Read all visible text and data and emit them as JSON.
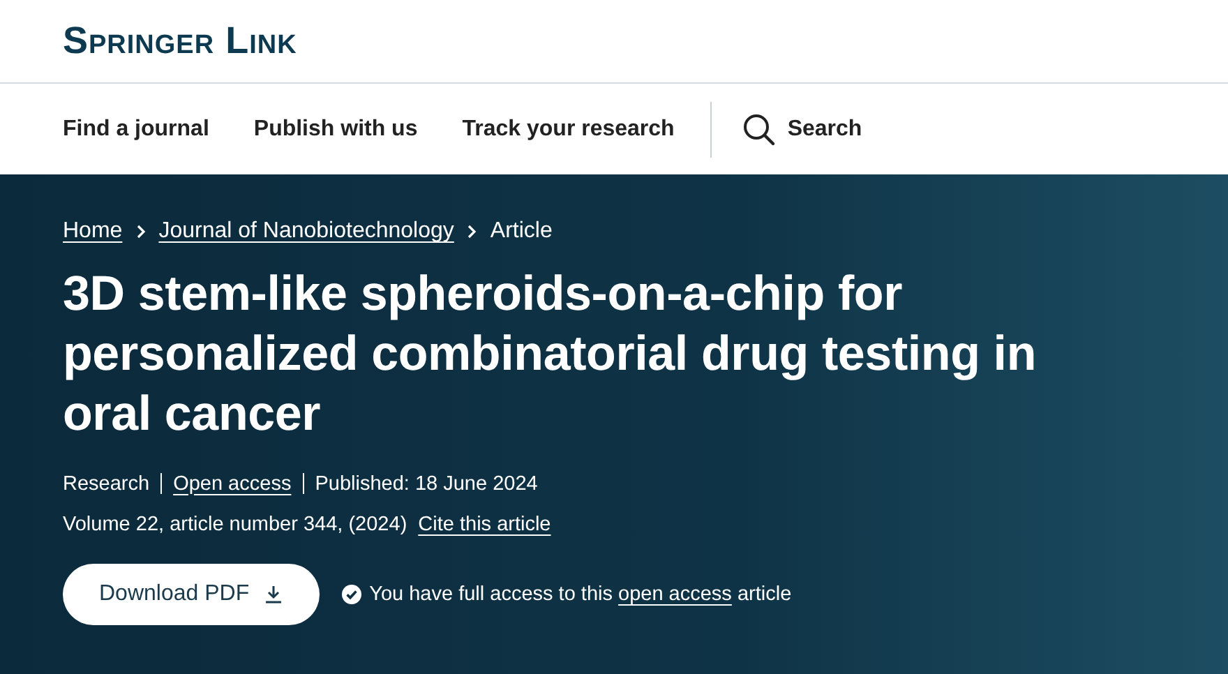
{
  "logo": "Springer Link",
  "nav": [
    "Find a journal",
    "Publish with us",
    "Track your research"
  ],
  "search": {
    "label": "Search"
  },
  "breadcrumb": [
    {
      "label": "Home",
      "link": true
    },
    {
      "label": "Journal of Nanobiotechnology",
      "link": true
    },
    {
      "label": "Article",
      "link": false
    }
  ],
  "title": "3D stem-like spheroids-on-a-chip for personalized combinatorial drug testing in oral cancer",
  "meta": [
    {
      "label": "Research",
      "link": false
    },
    {
      "label": "Open access",
      "link": true
    },
    {
      "label": "Published: 18 June 2024",
      "link": false
    }
  ],
  "citation": {
    "text": "Volume 22, article number 344, (2024)",
    "cite": "Cite this article"
  },
  "download": {
    "label": "Download PDF"
  },
  "access": {
    "before": "You have full access to this",
    "link": "open access",
    "after": "article"
  }
}
